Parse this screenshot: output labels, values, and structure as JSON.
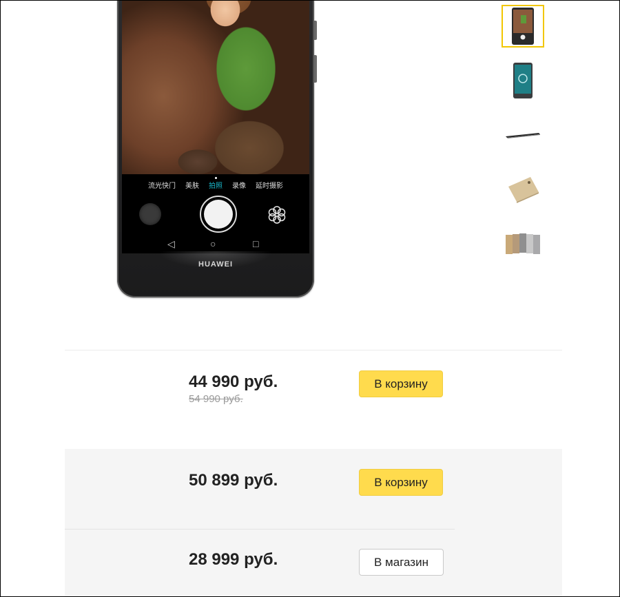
{
  "product": {
    "camera_modes": [
      "流光快门",
      "美肤",
      "拍照",
      "录像",
      "延时摄影"
    ],
    "active_mode_index": 2,
    "brand": "HUAWEI",
    "thumbnails": [
      {
        "name": "front-camera-view",
        "selected": true
      },
      {
        "name": "front-screen-view",
        "selected": false
      },
      {
        "name": "side-profile-view",
        "selected": false
      },
      {
        "name": "back-gold-view",
        "selected": false
      },
      {
        "name": "color-variants-view",
        "selected": false
      }
    ]
  },
  "offers": [
    {
      "price": "44 990 руб.",
      "old_price": "54 990 руб.",
      "button": "В корзину"
    },
    {
      "price": "50 899 руб.",
      "button": "В корзину"
    },
    {
      "price": "28 999 руб.",
      "button": "В магазин"
    }
  ],
  "colors": {
    "accent_yellow": "#ffdb4d",
    "selection_border": "#f2c600",
    "active_mode": "#19b6c9"
  }
}
